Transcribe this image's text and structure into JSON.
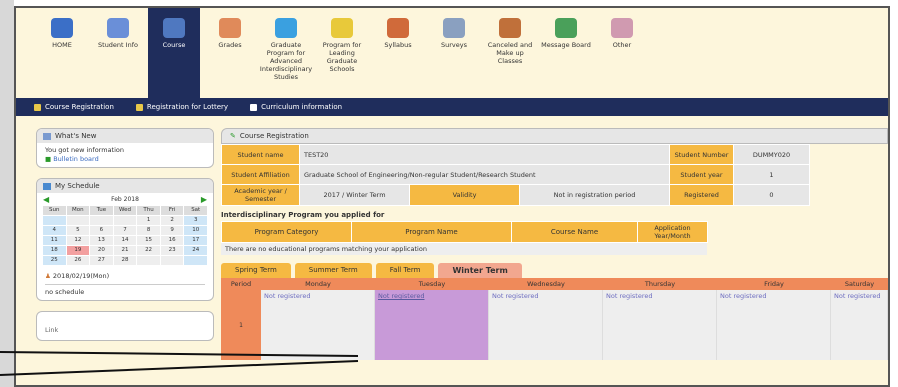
{
  "nav": {
    "items": [
      {
        "label": "HOME",
        "icon": "home-icon",
        "color": "#3b6fc7"
      },
      {
        "label": "Student Info",
        "icon": "student-info-icon",
        "color": "#6a8fd8"
      },
      {
        "label": "Course",
        "icon": "course-icon",
        "color": "#4f78c0"
      },
      {
        "label": "Grades",
        "icon": "grades-icon",
        "color": "#e08a5a"
      },
      {
        "label": "Graduate Program for Advanced Interdisciplinary Studies",
        "icon": "graduate-program-icon",
        "color": "#3aa0e0"
      },
      {
        "label": "Program for Leading Graduate Schools",
        "icon": "leading-program-icon",
        "color": "#e8c93a"
      },
      {
        "label": "Syllabus",
        "icon": "syllabus-icon",
        "color": "#d06a3a"
      },
      {
        "label": "Surveys",
        "icon": "surveys-icon",
        "color": "#8aa0c0"
      },
      {
        "label": "Canceled and Make up Classes",
        "icon": "canceled-classes-icon",
        "color": "#c0703a"
      },
      {
        "label": "Message Board",
        "icon": "message-board-icon",
        "color": "#4aa05a"
      },
      {
        "label": "Other",
        "icon": "other-icon",
        "color": "#d09ab0"
      }
    ],
    "active_index": 2
  },
  "subnav": [
    "Course Registration",
    "Registration for Lottery",
    "Curriculum information"
  ],
  "whats_new": {
    "title": "What's New",
    "text": "You got new information",
    "link": "Bulletin board"
  },
  "schedule": {
    "title": "My Schedule",
    "month": "Feb 2018",
    "weekdays": [
      "Sun",
      "Mon",
      "Tue",
      "Wed",
      "Thu",
      "Fri",
      "Sat"
    ],
    "days": [
      "",
      "",
      "",
      "",
      "1",
      "2",
      "3",
      "4",
      "5",
      "6",
      "7",
      "8",
      "9",
      "10",
      "11",
      "12",
      "13",
      "14",
      "15",
      "16",
      "17",
      "18",
      "19",
      "20",
      "21",
      "22",
      "23",
      "24",
      "25",
      "26",
      "27",
      "28",
      "",
      "",
      ""
    ],
    "date_entry": "2018/02/19(Mon)",
    "no_schedule": "no schedule",
    "extra": "Link"
  },
  "registration": {
    "title": "Course Registration",
    "student_name_label": "Student name",
    "student_name": "TEST20",
    "student_number_label": "Student Number",
    "student_number": "DUMMY020",
    "affiliation_label": "Student Affiliation",
    "affiliation": "Graduate School of Engineering/Non-regular Student/Research Student",
    "student_year_label": "Student year",
    "student_year": "1",
    "academic_year_label": "Academic year / Semester",
    "academic_year": "2017 / Winter Term",
    "validity_label": "Validity",
    "validity": "Not in registration period",
    "registered_label": "Registered",
    "registered": "0"
  },
  "interdisciplinary": {
    "title": "Interdisciplinary Program you applied for",
    "headers": [
      "Program Category",
      "Program Name",
      "Course Name",
      "Application Year/Month"
    ],
    "empty": "There are no educational programs matching your application"
  },
  "terms": [
    "Spring Term",
    "Summer Term",
    "Fall Term",
    "Winter Term"
  ],
  "active_term": "Winter Term",
  "timetable": {
    "period_label": "Period",
    "days": [
      "Monday",
      "Tuesday",
      "Wednesday",
      "Thursday",
      "Friday",
      "Saturday"
    ],
    "period": "1",
    "cells": [
      "Not registered",
      "Not registered",
      "Not registered",
      "Not registered",
      "Not registered",
      "Not registered"
    ]
  },
  "colors": {
    "navy": "#1f2d5c",
    "orange": "#f5b942",
    "salmon": "#ef8a5a",
    "highlight": "#c89ad8"
  }
}
